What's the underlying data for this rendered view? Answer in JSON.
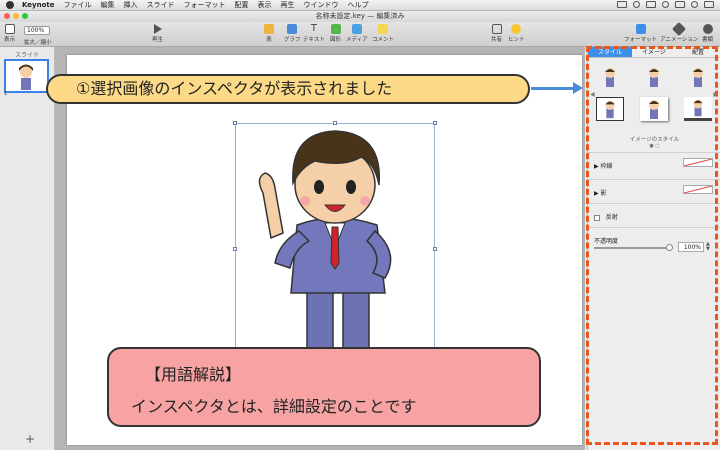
{
  "menubar": {
    "app": "Keynote",
    "items": [
      "ファイル",
      "編集",
      "挿入",
      "スライド",
      "フォーマット",
      "配置",
      "表示",
      "再生",
      "ウインドウ",
      "ヘルプ"
    ]
  },
  "window": {
    "title": "名称未設定.key — 編集済み"
  },
  "toolbar": {
    "view_label": "表示",
    "zoom_value": "100%",
    "zoom_label": "拡大／縮小",
    "play_label": "再生",
    "table_label": "表",
    "chart_label": "グラフ",
    "text_label": "テキスト",
    "shape_label": "図形",
    "media_label": "メディア",
    "comment_label": "コメント",
    "share_label": "共有",
    "tips_label": "ヒント",
    "format_label": "フォーマット",
    "animation_label": "アニメーション",
    "document_label": "書類"
  },
  "sidebar": {
    "header": "スライド",
    "slide_number": "1",
    "add_label": "+"
  },
  "inspector": {
    "tabs": [
      "スタイル",
      "イメージ",
      "配置"
    ],
    "active_tab": "スタイル",
    "style_caption": "イメージのスタイル",
    "border_label": "枠線",
    "shadow_label": "影",
    "reflection_label": "反射",
    "opacity_label": "不透明度",
    "opacity_value": "100%"
  },
  "callout_top": "①選択画像のインスペクタが表示されました",
  "callout_bottom": {
    "line1": "【用語解説】",
    "line2": "インスペクタとは、詳細設定のことです"
  },
  "colors": {
    "accent": "#3d8fe8",
    "highlight_border": "#e8581c",
    "callout_top_bg": "#fbd987",
    "callout_bottom_bg": "#f7a3a3"
  }
}
